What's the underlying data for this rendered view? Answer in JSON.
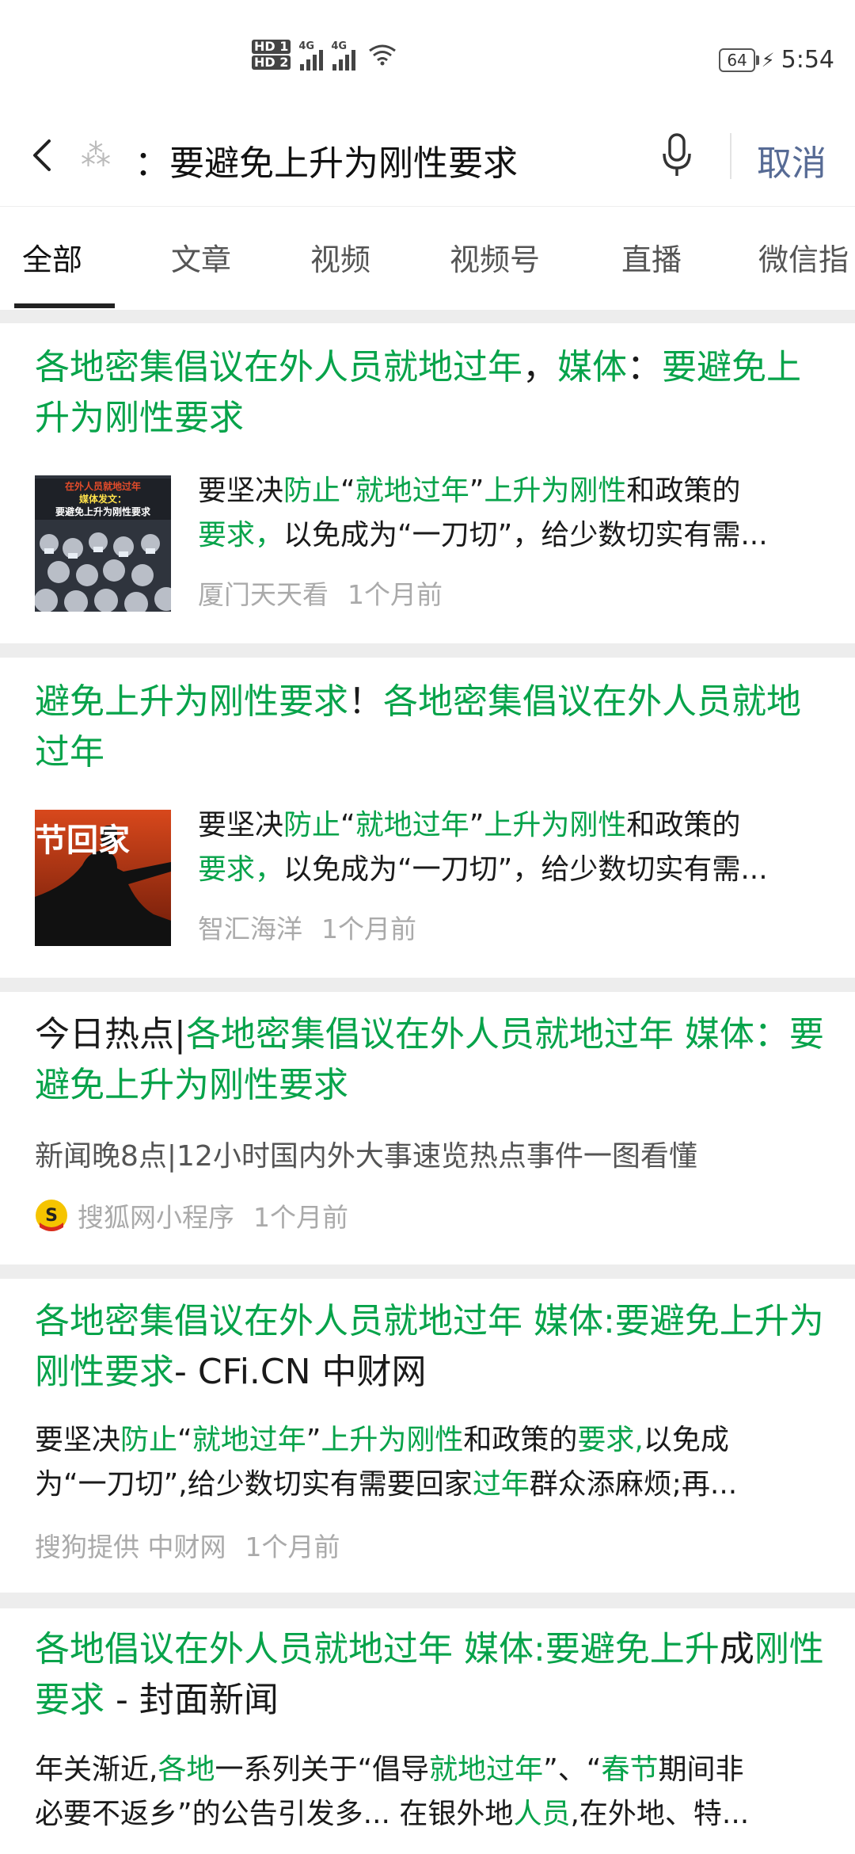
{
  "status_bar": {
    "hd1": "HD 1",
    "hd2": "HD 2",
    "net1": "4G",
    "net2": "4G",
    "battery": "64",
    "time": "5:54"
  },
  "search": {
    "query": "要避免上升为刚性要求",
    "separator": "：",
    "cancel": "取消",
    "icons": [
      "back-arrow-icon",
      "loading-spinner-icon",
      "microphone-icon"
    ]
  },
  "tabs": [
    "全部",
    "文章",
    "视频",
    "视频号",
    "直播",
    "微信指"
  ],
  "accent_color": "#07a34a",
  "results": [
    {
      "title_parts": [
        {
          "t": "各地密集倡议在外人员就地过年",
          "hl": true
        },
        {
          "t": "，",
          "hl": false
        },
        {
          "t": "媒体",
          "hl": true
        },
        {
          "t": "：",
          "hl": false
        },
        {
          "t": "要避免上升为刚性要求",
          "hl": true
        }
      ],
      "thumb_text": [
        "在外人员就地过年",
        "媒体发文：",
        "要避免上升为刚性要求"
      ],
      "desc_line1": [
        {
          "t": "要坚决",
          "hl": false
        },
        {
          "t": "防止",
          "hl": true
        },
        {
          "t": "“",
          "hl": false
        },
        {
          "t": "就地过年",
          "hl": true
        },
        {
          "t": "”",
          "hl": false
        },
        {
          "t": "上升为刚性",
          "hl": true
        },
        {
          "t": "和政策的",
          "hl": false
        }
      ],
      "desc_line2": [
        {
          "t": "要求，",
          "hl": true
        },
        {
          "t": "以免成为“一刀切”，给少数切实有需...",
          "hl": false
        }
      ],
      "source": "厦门天天看",
      "time": "1个月前"
    },
    {
      "title_parts": [
        {
          "t": "避免上升为刚性要求",
          "hl": true
        },
        {
          "t": "！",
          "hl": false
        },
        {
          "t": "各地密集倡议在外人员就地过年",
          "hl": true
        }
      ],
      "thumb_text": [
        "节回家"
      ],
      "desc_line1": [
        {
          "t": "要坚决",
          "hl": false
        },
        {
          "t": "防止",
          "hl": true
        },
        {
          "t": "“",
          "hl": false
        },
        {
          "t": "就地过年",
          "hl": true
        },
        {
          "t": "”",
          "hl": false
        },
        {
          "t": "上升为刚性",
          "hl": true
        },
        {
          "t": "和政策的",
          "hl": false
        }
      ],
      "desc_line2": [
        {
          "t": "要求，",
          "hl": true
        },
        {
          "t": "以免成为“一刀切”，给少数切实有需...",
          "hl": false
        }
      ],
      "source": "智汇海洋",
      "time": "1个月前"
    },
    {
      "title_parts": [
        {
          "t": "今日热点|",
          "hl": false
        },
        {
          "t": "各地密集倡议在外人员就地过年 媒体：要避免上升为刚性要求",
          "hl": true
        }
      ],
      "desc": "新闻晚8点|12小时国内外大事速览热点事件一图看懂",
      "source": "搜狐网小程序",
      "time": "1个月前"
    },
    {
      "title_parts": [
        {
          "t": "各地密集倡议在外人员就地过年 媒体:要避免上升为刚性要求",
          "hl": true
        },
        {
          "t": "- CFi.CN 中财网",
          "hl": false
        }
      ],
      "desc_line1": [
        {
          "t": "要坚决",
          "hl": false
        },
        {
          "t": "防止",
          "hl": true
        },
        {
          "t": "“",
          "hl": false
        },
        {
          "t": "就地过年",
          "hl": true
        },
        {
          "t": "”",
          "hl": false
        },
        {
          "t": "上升为刚性",
          "hl": true
        },
        {
          "t": "和政策的",
          "hl": false
        },
        {
          "t": "要求,",
          "hl": true
        },
        {
          "t": "以免成",
          "hl": false
        }
      ],
      "desc_line2": [
        {
          "t": "为“一刀切”,给少数切实有需要回家",
          "hl": false
        },
        {
          "t": "过年",
          "hl": true
        },
        {
          "t": "群众添麻烦;再...",
          "hl": false
        }
      ],
      "source": "搜狗提供 中财网",
      "time": "1个月前"
    },
    {
      "title_parts": [
        {
          "t": "各地倡议在外人员就地过年 媒体:要避免上升",
          "hl": true
        },
        {
          "t": "成",
          "hl": false
        },
        {
          "t": "刚性要求",
          "hl": true
        },
        {
          "t": " - 封面新闻",
          "hl": false
        }
      ],
      "desc_line1": [
        {
          "t": "年关渐近,",
          "hl": false
        },
        {
          "t": "各地",
          "hl": true
        },
        {
          "t": "一系列关于“倡导",
          "hl": false
        },
        {
          "t": "就地过年",
          "hl": true
        },
        {
          "t": "”、“",
          "hl": false
        },
        {
          "t": "春节",
          "hl": true
        },
        {
          "t": "期间非",
          "hl": false
        }
      ],
      "desc_line2": [
        {
          "t": "必要不返乡”的公告引发多... 在银外地",
          "hl": false
        },
        {
          "t": "人员",
          "hl": true
        },
        {
          "t": ",在外地、特...",
          "hl": false
        }
      ]
    }
  ]
}
